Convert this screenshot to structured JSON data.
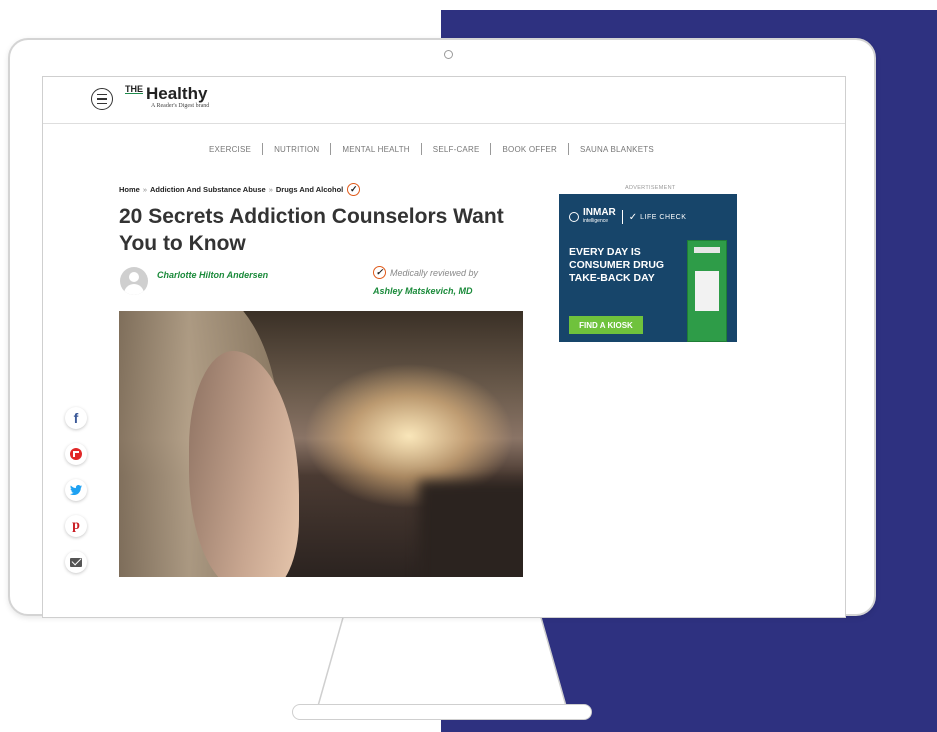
{
  "site": {
    "logo_the": "THE",
    "logo_name": "Healthy",
    "logo_subtitle": "A Reader's Digest brand"
  },
  "nav": {
    "items": [
      "EXERCISE",
      "NUTRITION",
      "MENTAL HEALTH",
      "SELF-CARE",
      "BOOK OFFER",
      "SAUNA BLANKETS"
    ]
  },
  "breadcrumb": {
    "items": [
      "Home",
      "Addiction And Substance Abuse",
      "Drugs And Alcohol"
    ],
    "separator": "»"
  },
  "article": {
    "title": "20 Secrets Addiction Counselors Want You to Know",
    "author": "Charlotte Hilton Andersen",
    "reviewed_label": "Medically reviewed by",
    "reviewer": "Ashley Matskevich, MD"
  },
  "ad": {
    "label": "ADVERTISEMENT",
    "brand1": "INMAR",
    "brand1_sub": "intelligence",
    "brand2": "LIFE CHECK",
    "headline": "EVERY DAY IS CONSUMER DRUG TAKE-BACK DAY",
    "button": "FIND A KIOSK"
  },
  "social": {
    "icons": [
      "facebook-icon",
      "flipboard-icon",
      "twitter-icon",
      "pinterest-icon",
      "email-icon"
    ]
  },
  "colors": {
    "navy": "#2e3180",
    "green": "#1a8a3a",
    "ad_bg": "#17456a",
    "ad_button": "#6fc23c",
    "check_ring": "#e05a1a"
  }
}
